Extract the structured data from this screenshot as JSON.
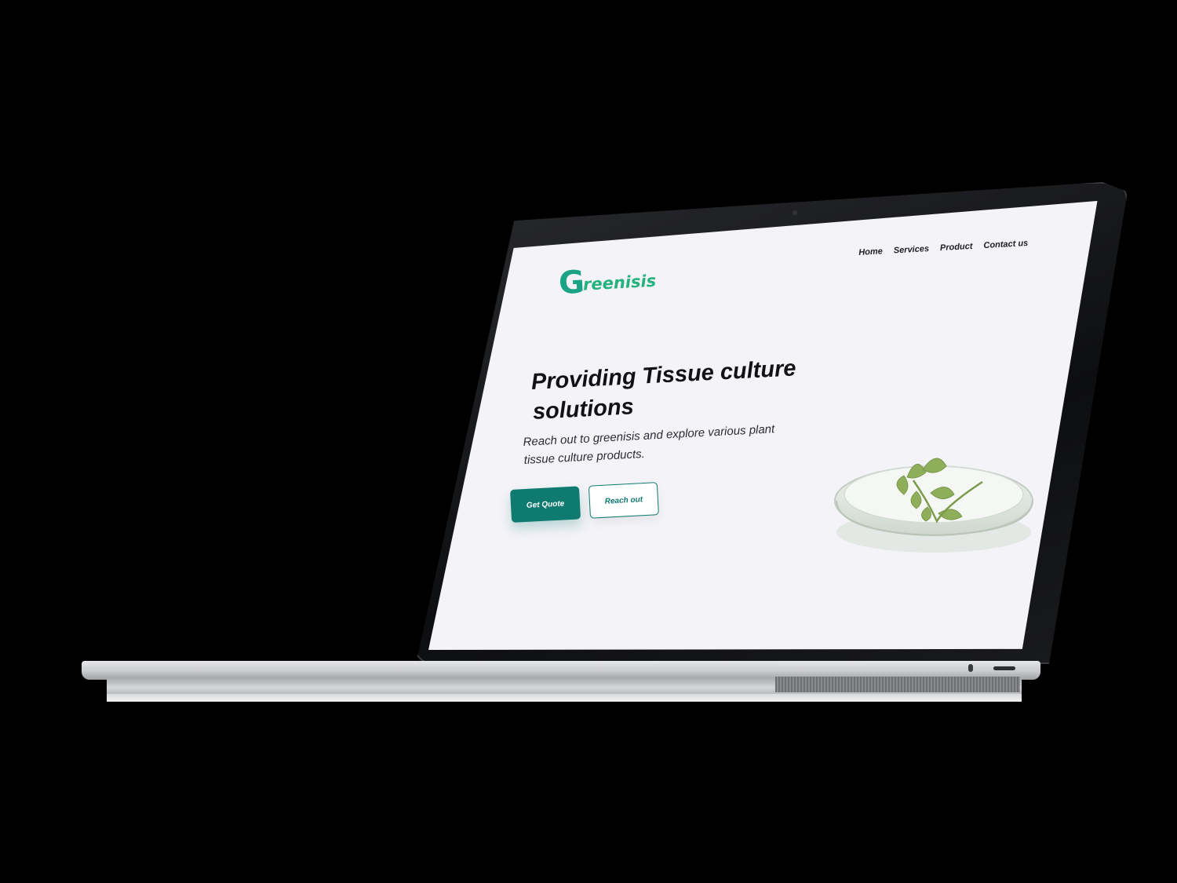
{
  "brand": {
    "logo_letter": "G",
    "logo_text": "reenisis",
    "color_primary": "#0f7a70",
    "color_logo": "#1aa384"
  },
  "nav": {
    "items": [
      {
        "label": "Home"
      },
      {
        "label": "Services"
      },
      {
        "label": "Product"
      },
      {
        "label": "Contact us"
      }
    ]
  },
  "hero": {
    "title": "Providing Tissue culture solutions",
    "subtitle": "Reach out to greenisis and explore various plant tissue culture products."
  },
  "buttons": {
    "primary_label": "Get Quote",
    "secondary_label": "Reach out"
  },
  "illustration": {
    "icon": "petri-dish-plant-icon"
  }
}
